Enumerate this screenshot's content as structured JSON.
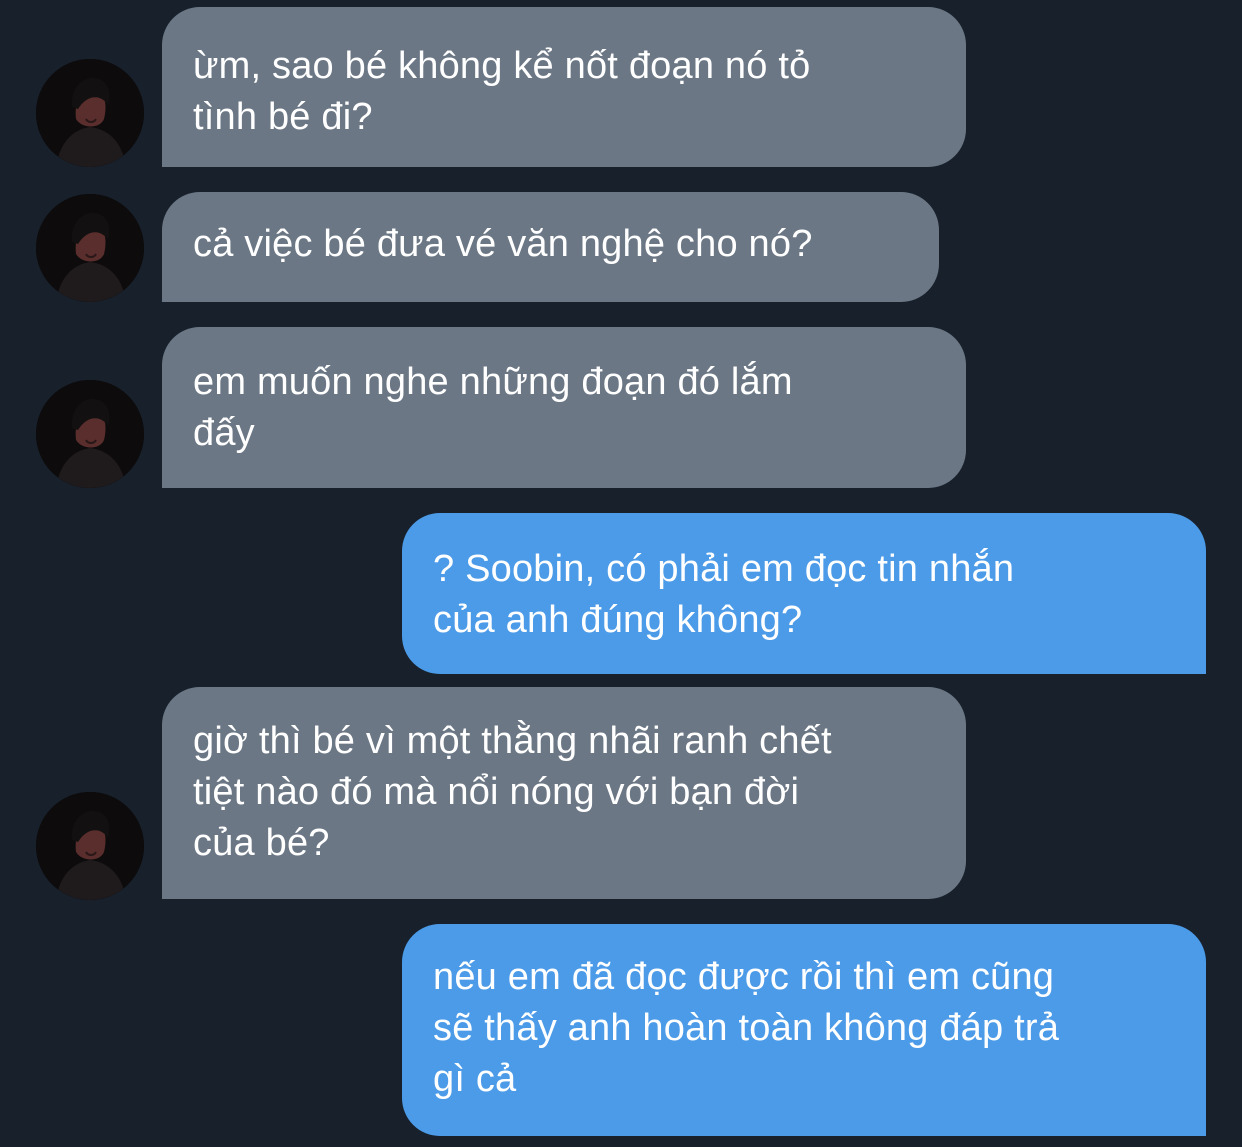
{
  "colors": {
    "background": "#17202b",
    "incoming_bubble": "#6b7785",
    "outgoing_bubble": "#4c9be8",
    "text": "#ffffff"
  },
  "avatar": {
    "icon": "user-avatar-photo"
  },
  "messages": [
    {
      "direction": "incoming",
      "text": "ừm, sao bé không kể nốt đoạn nó tỏ\ntình bé đi?"
    },
    {
      "direction": "incoming",
      "text": "cả việc bé đưa vé văn nghệ cho nó?"
    },
    {
      "direction": "incoming",
      "text": "em muốn nghe những đoạn đó lắm\nđấy"
    },
    {
      "direction": "outgoing",
      "text": "? Soobin, có phải em đọc tin nhắn\ncủa anh đúng không?"
    },
    {
      "direction": "incoming",
      "text": "giờ thì bé vì một thằng nhãi ranh chết\ntiệt nào đó mà nổi nóng với bạn đời\ncủa bé?"
    },
    {
      "direction": "outgoing",
      "text": "nếu em đã đọc được rồi thì em cũng\nsẽ thấy anh hoàn toàn không đáp trả\ngì cả"
    }
  ]
}
